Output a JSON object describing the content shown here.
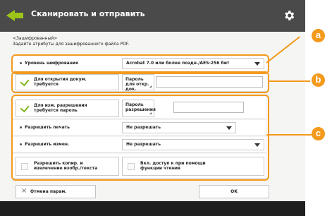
{
  "header": {
    "title": "Сканировать и отправить",
    "back_icon": "back-arrow-icon",
    "settings_icon": "gear-icon"
  },
  "section": {
    "heading_line1": "<Зашифрованный>",
    "heading_line2": "Задайте атрибуты для зашифрованного файла PDF."
  },
  "encryption_level": {
    "label": "Уровень шифрования",
    "value": "Acrobat 7.0 или более поздн./AES-256 бит"
  },
  "open_password": {
    "toggle_label": "Для открытия докум. требуется",
    "checked": true,
    "password_button": "Пароль для откр. док."
  },
  "permissions_password": {
    "toggle_label": "Для изм. разрешения требуется пароль",
    "checked": true,
    "password_button": "Пароль разрешения"
  },
  "allow_printing": {
    "label": "Разрешить печать",
    "value": "Не разрешать"
  },
  "allow_changes": {
    "label": "Разрешить измен.",
    "value": "Не разрешать"
  },
  "options": {
    "copy_extraction": "Разрешить копир. и извлечение изобр./текста",
    "accessibility": "Вкл. доступ к при помощи функции чтения"
  },
  "footer_buttons": {
    "cancel_label": "Отмена парам.",
    "ok_label": "OK"
  },
  "callouts": [
    "a",
    "b",
    "c"
  ],
  "colors": {
    "titlebar": "#4a4a4a",
    "accent_green": "#9dc41a",
    "callout_orange": "#f39a1d",
    "footer": "#1f1f1f"
  }
}
